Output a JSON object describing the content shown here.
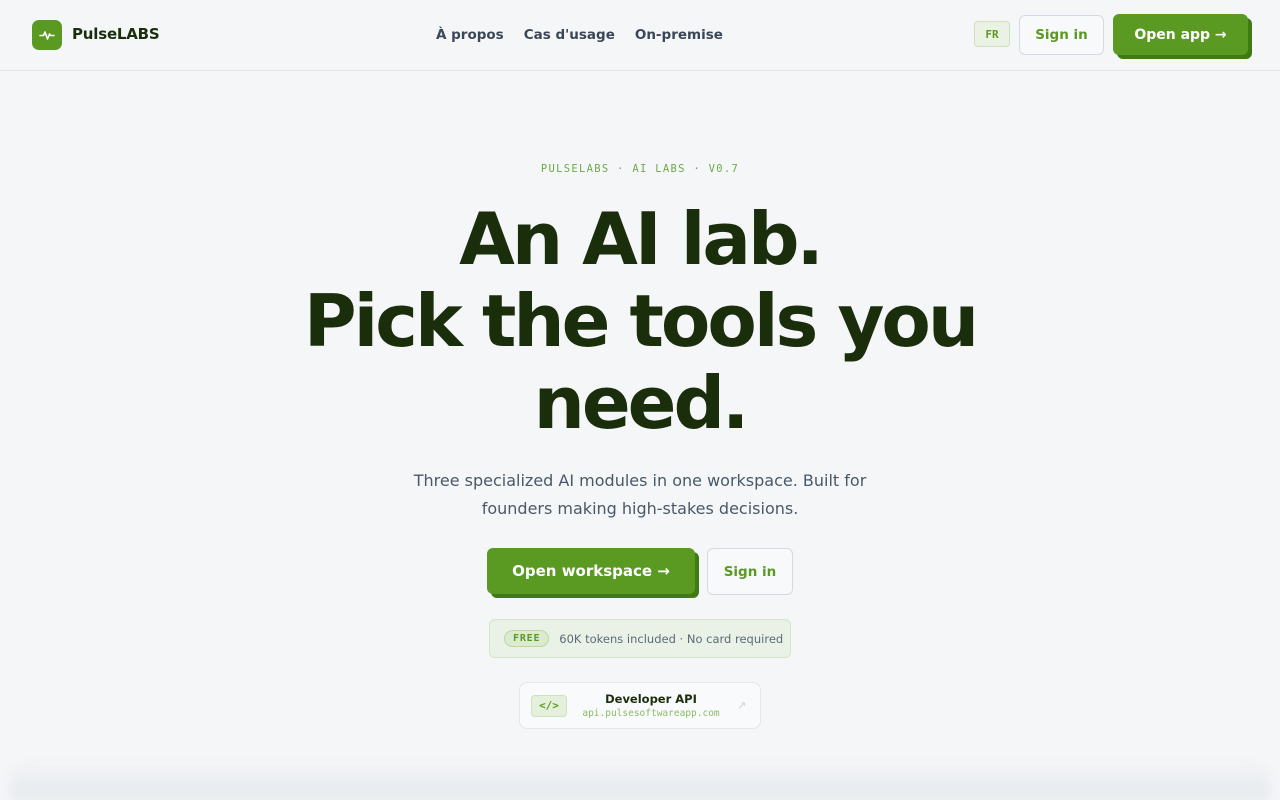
{
  "brand": {
    "name": "PulseLABS",
    "logo_icon": "pulse-icon"
  },
  "nav": {
    "links": [
      "À propos",
      "Cas d'usage",
      "On-premise"
    ],
    "lang": "FR",
    "signin_label": "Sign in",
    "openapp_label": "Open app →"
  },
  "hero": {
    "eyebrow": "PULSELABS · AI LABS · V0.7",
    "headline_lines": [
      "An AI lab.",
      "Pick the tools you",
      "need."
    ],
    "subtitle": "Three specialized AI modules in one workspace. Built for founders making high-stakes decisions.",
    "cta_primary": "Open workspace →",
    "cta_secondary": "Sign in",
    "free_badge": "FREE",
    "free_text": "60K tokens included · No card required",
    "api_icon": "</>",
    "api_title": "Developer API",
    "api_url": "api.pulsesoftwareapp.com",
    "api_arrow": "↗"
  },
  "colors": {
    "accent": "#5a9a22",
    "accent_shadow": "#3f7a12",
    "text_dark": "#1b2e0c",
    "background": "#f4f6f8"
  }
}
